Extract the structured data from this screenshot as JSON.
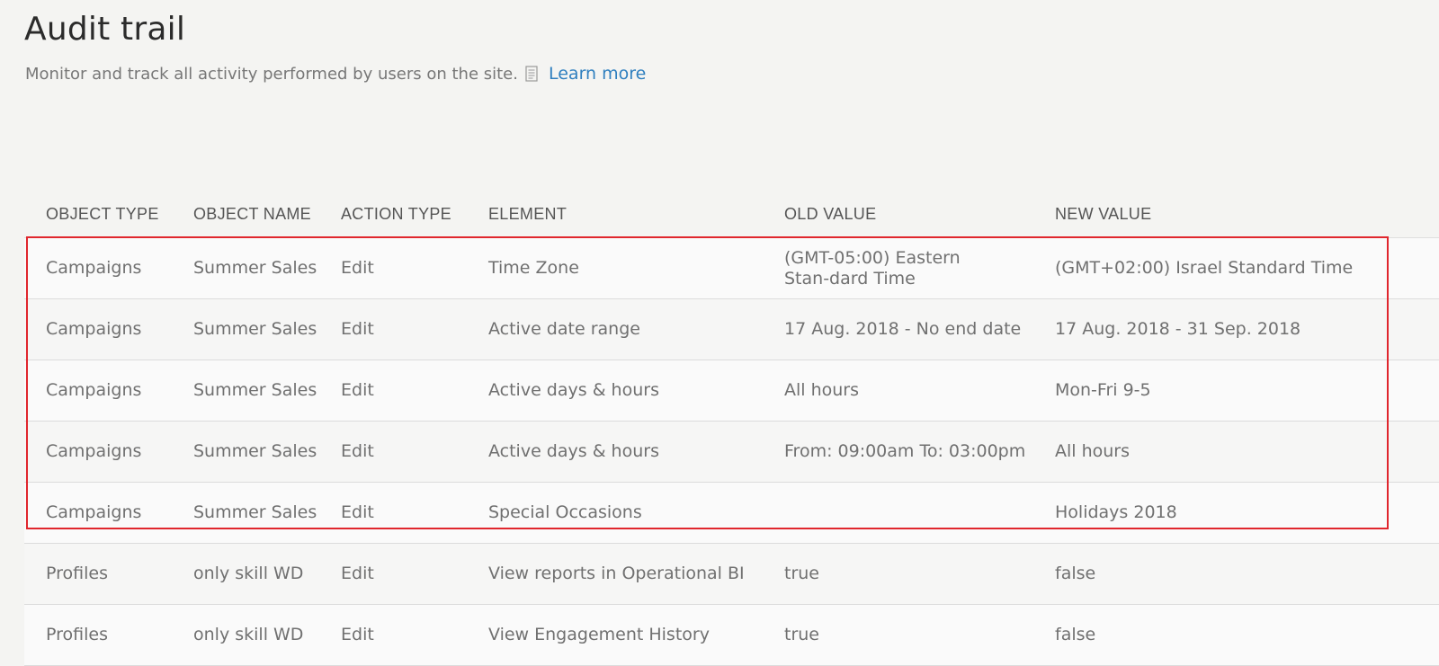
{
  "page": {
    "title": "Audit trail",
    "subtitle": "Monitor and track all activity performed by users on the site.",
    "learn_more": "Learn more"
  },
  "table": {
    "headers": [
      "OBJECT TYPE",
      "OBJECT NAME",
      "ACTION TYPE",
      "ELEMENT",
      "OLD VALUE",
      "NEW VALUE"
    ],
    "rows": [
      [
        "Campaigns",
        "Summer Sales",
        "Edit",
        "Time Zone",
        "(GMT-05:00) Eastern Stan-dard Time",
        "(GMT+02:00) Israel Standard Time"
      ],
      [
        "Campaigns",
        "Summer Sales",
        "Edit",
        "Active date range",
        "17 Aug. 2018 - No end date",
        "17 Aug. 2018 - 31 Sep. 2018"
      ],
      [
        "Campaigns",
        "Summer Sales",
        "Edit",
        "Active days & hours",
        "All hours",
        "Mon-Fri 9-5"
      ],
      [
        "Campaigns",
        "Summer Sales",
        "Edit",
        "Active days & hours",
        "From: 09:00am To: 03:00pm",
        "All hours"
      ],
      [
        "Campaigns",
        "Summer Sales",
        "Edit",
        "Special Occasions",
        "",
        "Holidays 2018"
      ],
      [
        "Profiles",
        "only skill WD",
        "Edit",
        "View reports in Operational BI",
        "true",
        "false"
      ],
      [
        "Profiles",
        "only skill WD",
        "Edit",
        "View Engagement History",
        "true",
        "false"
      ]
    ]
  },
  "highlight": {
    "color": "#e0262d",
    "rows_highlighted": 5
  },
  "icons": {
    "doc": "document-icon"
  },
  "colors": {
    "link": "#2f7fbf",
    "background": "#f4f4f2"
  }
}
